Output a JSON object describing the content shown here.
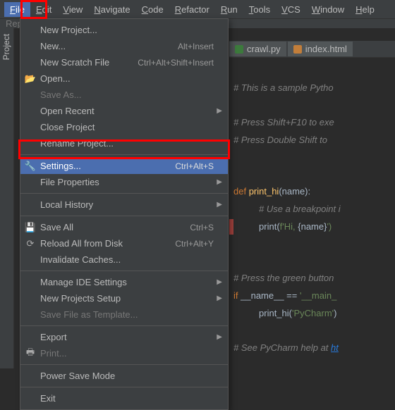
{
  "menubar": [
    "File",
    "Edit",
    "View",
    "Navigate",
    "Code",
    "Refactor",
    "Run",
    "Tools",
    "VCS",
    "Window",
    "Help"
  ],
  "tabstrip": {
    "label": "Rep"
  },
  "sidebar": {
    "project": "Project"
  },
  "editor_tabs": [
    {
      "name": "crawl.py",
      "kind": "py",
      "active": true
    },
    {
      "name": "index.html",
      "kind": "html",
      "active": false
    }
  ],
  "code": {
    "l1": "# This is a sample Pytho",
    "l2": "# Press Shift+F10 to exe",
    "l3": "# Press Double Shift to ",
    "l4_def": "def ",
    "l4_fn": "print_hi",
    "l4_par": "(name):",
    "l5": "# Use a breakpoint i",
    "l6_fn": "print",
    "l6_par": "(",
    "l6_pre": "f'",
    "l6_str": "Hi, ",
    "l6_brace": "{name}",
    "l6_end": "')",
    "l7": "# Press the green button",
    "l8_if": "if ",
    "l8_name": "__name__ == ",
    "l8_str": "'__main_",
    "l9_fn": "print_hi",
    "l9_par": "(",
    "l9_str": "'PyCharm'",
    "l9_end": ")",
    "l10a": "# See PyCharm help at ",
    "l10b": "ht"
  },
  "menu": [
    {
      "type": "item",
      "label": "New Project..."
    },
    {
      "type": "item",
      "label": "New...",
      "shortcut": "Alt+Insert",
      "u": 0
    },
    {
      "type": "item",
      "label": "New Scratch File",
      "shortcut": "Ctrl+Alt+Shift+Insert"
    },
    {
      "type": "item",
      "label": "Open...",
      "u": 0,
      "icon": "open"
    },
    {
      "type": "item",
      "label": "Save As...",
      "disabled": true
    },
    {
      "type": "item",
      "label": "Open Recent",
      "submenu": true
    },
    {
      "type": "item",
      "label": "Close Project"
    },
    {
      "type": "item",
      "label": "Rename Project..."
    },
    {
      "type": "sep"
    },
    {
      "type": "item",
      "label": "Settings...",
      "shortcut": "Ctrl+Alt+S",
      "u": 0,
      "icon": "settings",
      "selected": true
    },
    {
      "type": "item",
      "label": "File Properties",
      "submenu": true
    },
    {
      "type": "sep"
    },
    {
      "type": "item",
      "label": "Local History",
      "submenu": true,
      "u": 6
    },
    {
      "type": "sep"
    },
    {
      "type": "item",
      "label": "Save All",
      "shortcut": "Ctrl+S",
      "u": 0,
      "icon": "save"
    },
    {
      "type": "item",
      "label": "Reload All from Disk",
      "shortcut": "Ctrl+Alt+Y",
      "icon": "reload"
    },
    {
      "type": "item",
      "label": "Invalidate Caches..."
    },
    {
      "type": "sep"
    },
    {
      "type": "item",
      "label": "Manage IDE Settings",
      "submenu": true
    },
    {
      "type": "item",
      "label": "New Projects Setup",
      "submenu": true
    },
    {
      "type": "item",
      "label": "Save File as Template...",
      "disabled": true
    },
    {
      "type": "sep"
    },
    {
      "type": "item",
      "label": "Export",
      "submenu": true
    },
    {
      "type": "item",
      "label": "Print...",
      "icon": "print",
      "disabled": true,
      "u": 0
    },
    {
      "type": "sep"
    },
    {
      "type": "item",
      "label": "Power Save Mode"
    },
    {
      "type": "sep"
    },
    {
      "type": "item",
      "label": "Exit",
      "u": 1
    }
  ]
}
